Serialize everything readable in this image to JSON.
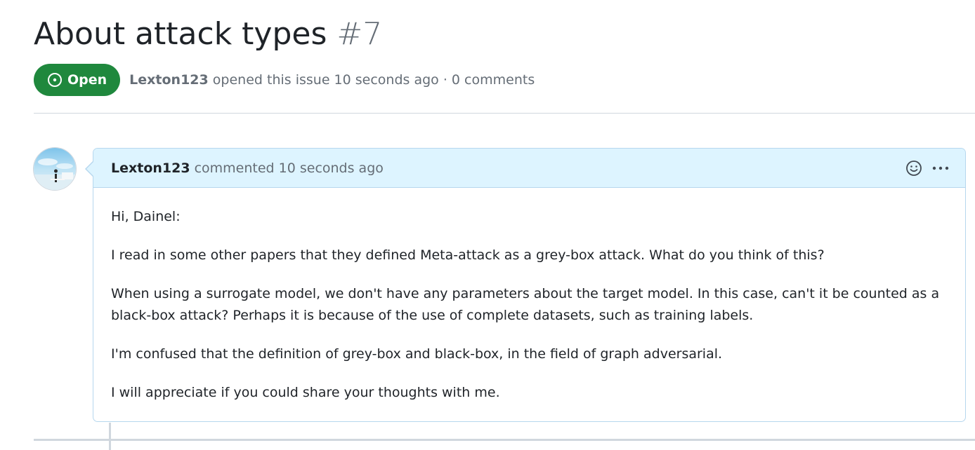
{
  "issue": {
    "title": "About attack types",
    "number": "#7",
    "state_label": "Open",
    "author": "Lexton123",
    "meta_suffix": "opened this issue 10 seconds ago · 0 comments"
  },
  "comment": {
    "author": "Lexton123",
    "action": "commented 10 seconds ago",
    "paragraphs": [
      "Hi, Dainel:",
      "I read in some other papers that they defined Meta-attack as a grey-box attack. What do you think of this?",
      "When using a surrogate model, we don't have any parameters about the target model. In this case, can't it be counted as a black-box attack? Perhaps it is because of the use of complete datasets, such as training labels.",
      "I'm confused that the definition of grey-box and black-box, in the field of graph adversarial.",
      "I will appreciate if you could share your thoughts with me."
    ]
  },
  "icons": {
    "state": "issue-opened-icon",
    "reaction": "smiley-icon",
    "menu": "kebab-horizontal-icon",
    "avatar": "user-avatar"
  },
  "colors": {
    "open_green": "#1f883d",
    "comment_header_bg": "#ddf4ff",
    "comment_border": "#b6d7ee",
    "muted_text": "#656d76"
  }
}
